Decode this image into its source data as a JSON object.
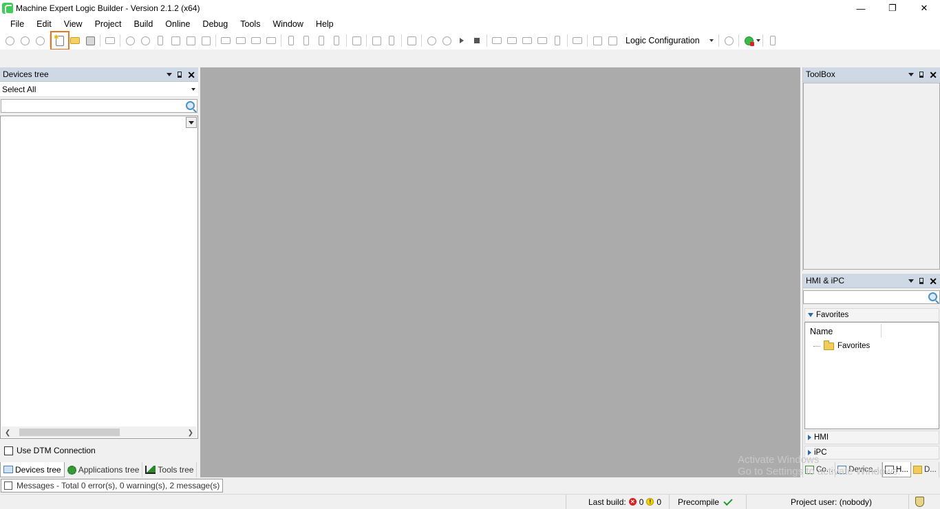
{
  "window": {
    "title": "Machine Expert Logic Builder - Version 2.1.2 (x64)",
    "controls": {
      "minimize": "—",
      "restore": "❐",
      "close": "✕"
    }
  },
  "menu": [
    "File",
    "Edit",
    "View",
    "Project",
    "Build",
    "Online",
    "Debug",
    "Tools",
    "Window",
    "Help"
  ],
  "toolbar": {
    "configuration": "Logic Configuration",
    "highlighted_button": "new-project",
    "accent": "#e87722"
  },
  "devices_panel": {
    "title": "Devices tree",
    "filter": "Select All",
    "search_value": "",
    "use_dtm_label": "Use DTM Connection",
    "use_dtm_checked": false,
    "tabs": [
      "Devices tree",
      "Applications tree",
      "Tools tree"
    ],
    "active_tab": "Devices tree"
  },
  "toolbox_panel": {
    "title": "ToolBox"
  },
  "hmi_panel": {
    "title": "HMI & iPC",
    "search_value": "",
    "favorites_header": "Favorites",
    "column_name": "Name",
    "favorites_item": "Favorites",
    "sections": [
      "HMI",
      "iPC"
    ],
    "tabs": [
      "Co...",
      "Device...",
      "H...",
      "D..."
    ]
  },
  "watermark": {
    "line1": "Activate Windows",
    "line2": "Go to Settings to activate Windows."
  },
  "messages": {
    "label": "Messages - Total 0 error(s), 0 warning(s), 2 message(s)"
  },
  "status": {
    "last_build_label": "Last build:",
    "errors": "0",
    "warnings": "0",
    "precompile": "Precompile",
    "project_user": "Project user: (nobody)"
  }
}
